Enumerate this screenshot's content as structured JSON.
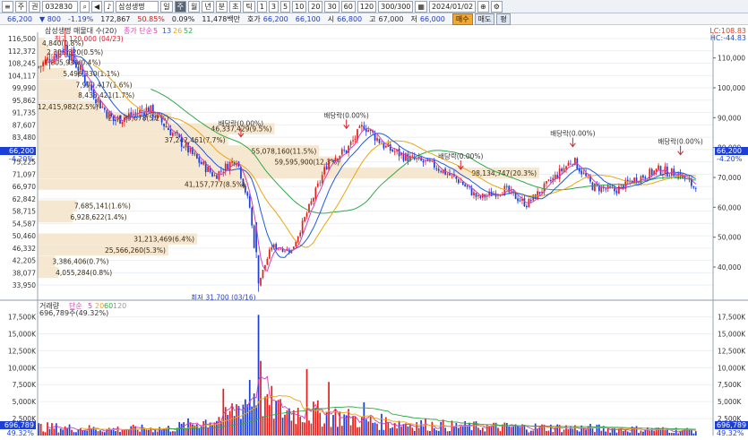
{
  "toolbar": {
    "type_label": "주",
    "exchange_label": "권",
    "code": "032830",
    "stock_name": "삼성생명",
    "intervals": [
      "일",
      "주",
      "월",
      "년",
      "분",
      "초",
      "틱"
    ],
    "minute_options": [
      "1",
      "3",
      "5",
      "10",
      "20",
      "30",
      "60",
      "120"
    ],
    "range": "300/300",
    "date": "2024/01/02"
  },
  "quote": {
    "price": "66,200",
    "change_arrow": "▼",
    "change": "800",
    "change_pct": "-1.19%",
    "volume": "172,867",
    "volume_ratio": "50.85%",
    "turnover_pct": "0.09%",
    "trade_value": "11,478백만",
    "bid_label": "호가",
    "bid": "66,200",
    "ask": "66,100",
    "open_label": "시",
    "open": "66,800",
    "high_label": "고",
    "high": "67,000",
    "low_label": "저",
    "low": "66,000",
    "buy_label": "매수",
    "sell_label": "매도",
    "avg_label": "평"
  },
  "icons": [
    "menu-icon",
    "search-icon",
    "prev-arrow-icon",
    "next-arrow-icon",
    "speaker-icon",
    "calendar-icon",
    "zoom-icon",
    "settings-icon"
  ],
  "colors": {
    "up": "#e3211c",
    "down": "#1c3fd8",
    "ma5": "#d43fb6",
    "ma13": "#1e5adf",
    "ma26": "#e9a614",
    "ma52": "#2fa848",
    "volbox": "#f5e4c8"
  },
  "price_panel": {
    "legend_title": "삼성생명 매물대 수(20)",
    "legend_ma_label": "종가 단순",
    "legend_ma_periods": [
      "5",
      "13",
      "26",
      "52"
    ],
    "lc_label": "LC:108.83",
    "hc_label": "HC:-44.83",
    "left_price_label": "66,200",
    "left_pct_label": "-4.20%",
    "right_price_label": "66,200",
    "right_pct_label": "-4.20%",
    "high_note": "최고 120,000 (04/23)",
    "low_note": "최저 31,700 (03/16)",
    "dividend_label": "배당락(0.00%)"
  },
  "volume_panel": {
    "legend_title": "거래량",
    "legend_ma_label": "단순",
    "legend_ma_periods": [
      "5",
      "20",
      "60",
      "120"
    ],
    "legend_value": "696,789주(49.32%)",
    "left_last": "696,789",
    "left_pct": "49.32%",
    "right_last": "696,789",
    "right_pct": "49.32%"
  },
  "chart_data": {
    "type": "candlestick",
    "y_left_ticks": [
      "116,500",
      "112,372",
      "108,245",
      "104,117",
      "99,990",
      "95,862",
      "91,735",
      "87,607",
      "83,480",
      "79,352",
      "75,225",
      "71,097",
      "66,970",
      "62,842",
      "58,715",
      "54,587",
      "50,460",
      "46,332",
      "42,205",
      "38,077",
      "33,950"
    ],
    "y_right_ticks": [
      "110,000",
      "100,000",
      "90,000",
      "80,000",
      "70,000",
      "60,000",
      "50,000",
      "40,000"
    ],
    "ylim": [
      31000,
      118000
    ],
    "volume_left_ticks": [
      "17,500K",
      "15,000K",
      "12,500K",
      "10,000K",
      "7,500K",
      "5,000K",
      "2,500K"
    ],
    "volume_right_ticks": [
      "17,500K",
      "15,000K",
      "12,500K",
      "10,000K",
      "7,500K",
      "5,000K",
      "2,500K"
    ],
    "volume_ylim": [
      0,
      18500
    ],
    "volume_profile": [
      {
        "price": 115000,
        "volume": "4,840(0.8%)"
      },
      {
        "price": 112000,
        "volume": "2,306,320(0.5%)"
      },
      {
        "price": 108500,
        "volume": "1,805,936(0.4%)"
      },
      {
        "price": 104800,
        "volume": "5,496,330(1.1%)"
      },
      {
        "price": 101000,
        "volume": "7,970,417(1.6%)"
      },
      {
        "price": 97600,
        "volume": "8,438,421(1.7%)"
      },
      {
        "price": 93700,
        "volume": "12,415,982(2.5%)"
      },
      {
        "price": 90000,
        "volume": "26,179,678(5.2%)"
      },
      {
        "price": 86300,
        "volume": "46,337,429(9.5%)"
      },
      {
        "price": 82600,
        "volume": "37,242,461(7.7%)"
      },
      {
        "price": 78900,
        "volume": "55,078,160(11.5%)"
      },
      {
        "price": 75200,
        "volume": "59,595,900(12.3%)"
      },
      {
        "price": 71500,
        "volume": "98,134,747(20.3%)"
      },
      {
        "price": 67700,
        "volume": "41,157,777(8.5%)"
      },
      {
        "price": 60500,
        "volume": "7,685,141(1.6%)"
      },
      {
        "price": 56800,
        "volume": "6,928,622(1.4%)"
      },
      {
        "price": 49400,
        "volume": "31,213,469(6.4%)"
      },
      {
        "price": 45700,
        "volume": "25,566,260(5.3%)"
      },
      {
        "price": 41900,
        "volume": "3,386,406(0.7%)"
      },
      {
        "price": 38200,
        "volume": "4,055,284(0.8%)"
      }
    ],
    "annotations": [
      {
        "text": "최고 120,000 (04/23)",
        "week": 12,
        "price": 118000
      },
      {
        "text": "최저 31,700 (03/16)",
        "week": 100,
        "price": 31700
      },
      {
        "text": "배당락(0.00%)",
        "week": 92,
        "price": 84800
      },
      {
        "text": "배당락(0.00%)",
        "week": 140,
        "price": 87600
      },
      {
        "text": "배당락(0.00%)",
        "week": 192,
        "price": 73900
      },
      {
        "text": "배당락(0.00%)",
        "week": 243,
        "price": 81500
      },
      {
        "text": "배당락(0.00%)",
        "week": 292,
        "price": 78800
      }
    ],
    "close_anchors": [
      {
        "week": 0,
        "close": 107000
      },
      {
        "week": 12,
        "close": 114000
      },
      {
        "week": 28,
        "close": 94500
      },
      {
        "week": 34,
        "close": 89000
      },
      {
        "week": 50,
        "close": 93000
      },
      {
        "week": 62,
        "close": 84000
      },
      {
        "week": 72,
        "close": 76000
      },
      {
        "week": 80,
        "close": 70500
      },
      {
        "week": 90,
        "close": 76500
      },
      {
        "week": 96,
        "close": 60000
      },
      {
        "week": 100,
        "close": 34500
      },
      {
        "week": 106,
        "close": 47000
      },
      {
        "week": 115,
        "close": 45500
      },
      {
        "week": 122,
        "close": 58000
      },
      {
        "week": 132,
        "close": 76000
      },
      {
        "week": 140,
        "close": 79000
      },
      {
        "week": 148,
        "close": 87500
      },
      {
        "week": 158,
        "close": 80000
      },
      {
        "week": 168,
        "close": 76500
      },
      {
        "week": 180,
        "close": 74000
      },
      {
        "week": 192,
        "close": 68500
      },
      {
        "week": 200,
        "close": 63000
      },
      {
        "week": 212,
        "close": 66000
      },
      {
        "week": 222,
        "close": 61000
      },
      {
        "week": 232,
        "close": 68000
      },
      {
        "week": 243,
        "close": 76000
      },
      {
        "week": 252,
        "close": 67000
      },
      {
        "week": 262,
        "close": 65500
      },
      {
        "week": 270,
        "close": 69000
      },
      {
        "week": 282,
        "close": 72500
      },
      {
        "week": 292,
        "close": 71000
      },
      {
        "week": 299,
        "close": 66200
      }
    ],
    "volume_anchors": [
      {
        "week": 0,
        "volume": 1200
      },
      {
        "week": 30,
        "volume": 900
      },
      {
        "week": 60,
        "volume": 1000
      },
      {
        "week": 85,
        "volume": 2600
      },
      {
        "week": 98,
        "volume": 6000
      },
      {
        "week": 110,
        "volume": 3500
      },
      {
        "week": 130,
        "volume": 3000
      },
      {
        "week": 150,
        "volume": 2000
      },
      {
        "week": 190,
        "volume": 1300
      },
      {
        "week": 240,
        "volume": 1100
      },
      {
        "week": 299,
        "volume": 700
      }
    ],
    "volume_spikes": [
      {
        "week": 100,
        "volume": 17800
      },
      {
        "week": 101,
        "volume": 11000
      },
      {
        "week": 84,
        "volume": 6900
      },
      {
        "week": 122,
        "volume": 9800
      },
      {
        "week": 132,
        "volume": 7900
      },
      {
        "week": 148,
        "volume": 4900
      },
      {
        "week": 96,
        "volume": 8200
      },
      {
        "week": 104,
        "volume": 6100
      }
    ]
  }
}
